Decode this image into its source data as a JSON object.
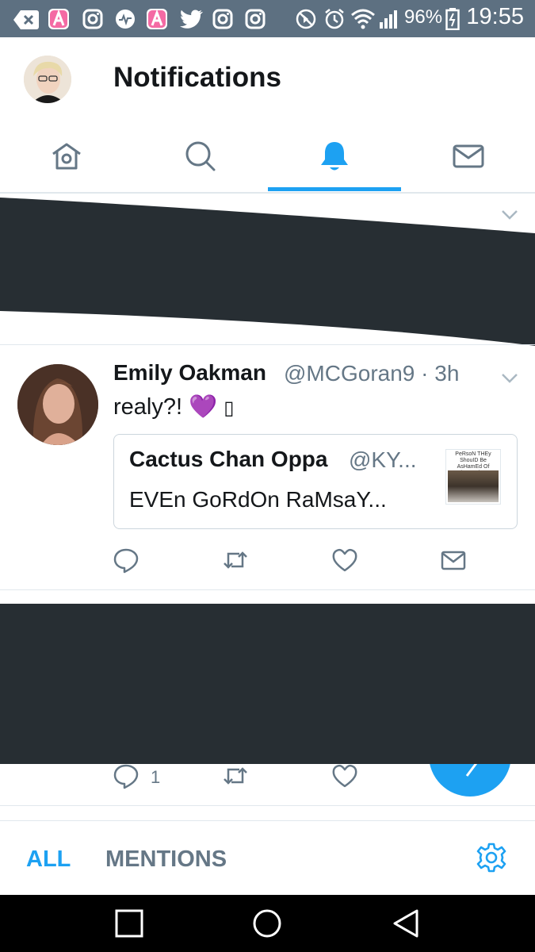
{
  "status_bar": {
    "battery": "96%",
    "time": "19:55",
    "icons": [
      "back-icon",
      "app-a-icon",
      "instagram-icon",
      "musically-icon",
      "app-a-icon",
      "twitter-icon",
      "instagram-icon",
      "instagram-icon",
      "mute-icon",
      "alarm-icon",
      "wifi-icon",
      "signal-icon",
      "battery-icon"
    ]
  },
  "header": {
    "title": "Notifications"
  },
  "tabs": [
    {
      "name": "home",
      "icon": "home-icon"
    },
    {
      "name": "search",
      "icon": "search-icon"
    },
    {
      "name": "notifications",
      "icon": "bell-icon",
      "active": true
    },
    {
      "name": "messages",
      "icon": "mail-icon"
    }
  ],
  "tweet": {
    "name": "Emily Oakman",
    "handle": "@MCGoran9 · 3h",
    "text": "realy?! 💜 ",
    "text_trailing_glyph": "▯",
    "quote": {
      "name": "Cactus Chan Oppa",
      "handle": "@KY...",
      "text": "EVEn GoRdOn RaMsaY...",
      "thumb_caption": "PeRsoN THEy ShouID Be AsHamEd Of ThemSelVes"
    }
  },
  "partial_tweet": {
    "reply_count": "1"
  },
  "filter_bar": {
    "all": "ALL",
    "mentions": "MENTIONS"
  },
  "colors": {
    "accent": "#1da1f2",
    "status_bar": "#5d7081",
    "redaction": "#272e33",
    "muted": "#657786"
  }
}
